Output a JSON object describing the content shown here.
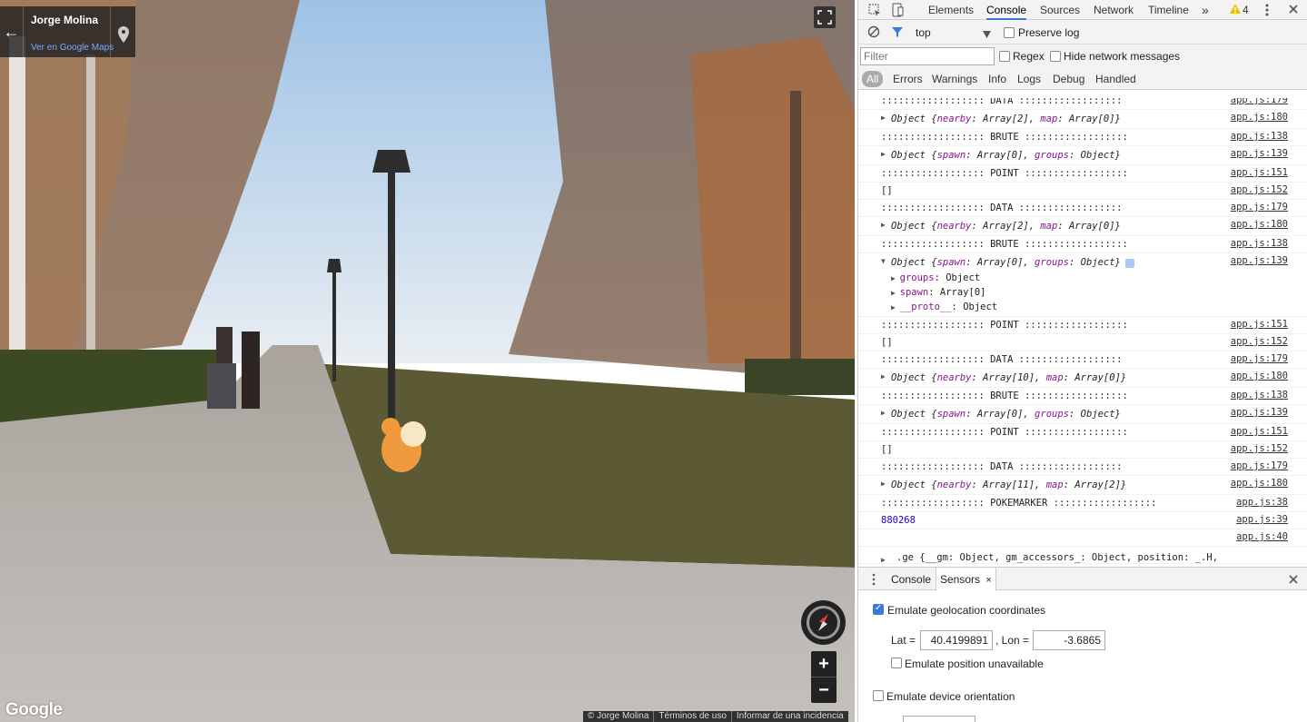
{
  "streetview": {
    "author": "Jorge Molina",
    "maps_link": "Ver en Google Maps",
    "back_glyph": "←",
    "zoom_in": "+",
    "zoom_out": "−",
    "google_logo": "Google",
    "footer": [
      "© Jorge Molina",
      "Términos de uso",
      "Informar de una incidencia"
    ]
  },
  "devtools": {
    "tabs": [
      "Elements",
      "Console",
      "Sources",
      "Network",
      "Timeline"
    ],
    "active_tab": "Console",
    "more_glyph": "»",
    "warning_count": "4",
    "context": "top",
    "preserve_log": "Preserve log",
    "filter_placeholder": "Filter",
    "regex": "Regex",
    "hide_network": "Hide network messages",
    "levels": [
      "All",
      "Errors",
      "Warnings",
      "Info",
      "Logs",
      "Debug",
      "Handled"
    ],
    "console_rows": [
      {
        "type": "text",
        "text": ":::::::::::::::::: DATA ::::::::::::::::::",
        "src": "app.js:179"
      },
      {
        "type": "obj",
        "parts": [
          "Object {",
          "nearby",
          ": Array[2], ",
          "map",
          ": Array[0]}"
        ],
        "src": "app.js:180"
      },
      {
        "type": "text",
        "text": ":::::::::::::::::: BRUTE ::::::::::::::::::",
        "src": "app.js:138"
      },
      {
        "type": "obj",
        "parts": [
          "Object {",
          "spawn",
          ": Array[0], ",
          "groups",
          ": Object}"
        ],
        "src": "app.js:139"
      },
      {
        "type": "text",
        "text": ":::::::::::::::::: POINT ::::::::::::::::::",
        "src": "app.js:151"
      },
      {
        "type": "text",
        "text": "[]",
        "src": "app.js:152"
      },
      {
        "type": "text",
        "text": ":::::::::::::::::: DATA ::::::::::::::::::",
        "src": "app.js:179"
      },
      {
        "type": "obj",
        "parts": [
          "Object {",
          "nearby",
          ": Array[2], ",
          "map",
          ": Array[0]}"
        ],
        "src": "app.js:180"
      },
      {
        "type": "text",
        "text": ":::::::::::::::::: BRUTE ::::::::::::::::::",
        "src": "app.js:138"
      },
      {
        "type": "expanded",
        "parts": [
          "Object {",
          "spawn",
          ": Array[0], ",
          "groups",
          ": Object}"
        ],
        "children": [
          [
            "groups",
            ": Object"
          ],
          [
            "spawn",
            ": Array[0]"
          ],
          [
            "__proto__",
            ": Object"
          ]
        ],
        "src": "app.js:139"
      },
      {
        "type": "text",
        "text": ":::::::::::::::::: POINT ::::::::::::::::::",
        "src": "app.js:151"
      },
      {
        "type": "text",
        "text": "[]",
        "src": "app.js:152"
      },
      {
        "type": "text",
        "text": ":::::::::::::::::: DATA ::::::::::::::::::",
        "src": "app.js:179"
      },
      {
        "type": "obj",
        "parts": [
          "Object {",
          "nearby",
          ": Array[10], ",
          "map",
          ": Array[0]}"
        ],
        "src": "app.js:180"
      },
      {
        "type": "text",
        "text": ":::::::::::::::::: BRUTE ::::::::::::::::::",
        "src": "app.js:138"
      },
      {
        "type": "obj",
        "parts": [
          "Object {",
          "spawn",
          ": Array[0], ",
          "groups",
          ": Object}"
        ],
        "src": "app.js:139"
      },
      {
        "type": "text",
        "text": ":::::::::::::::::: POINT ::::::::::::::::::",
        "src": "app.js:151"
      },
      {
        "type": "text",
        "text": "[]",
        "src": "app.js:152"
      },
      {
        "type": "text",
        "text": ":::::::::::::::::: DATA ::::::::::::::::::",
        "src": "app.js:179"
      },
      {
        "type": "obj",
        "parts": [
          "Object {",
          "nearby",
          ": Array[11], ",
          "map",
          ": Array[2]}"
        ],
        "src": "app.js:180"
      },
      {
        "type": "text",
        "text": ":::::::::::::::::: POKEMARKER ::::::::::::::::::",
        "src": "app.js:38"
      },
      {
        "type": "num",
        "text": "880268",
        "src": "app.js:39"
      },
      {
        "type": "text",
        "text": "",
        "src": "app.js:40"
      },
      {
        "type": "ge",
        "text": ".ge {__gm: Object, gm_accessors_: Object, position: _.H,",
        "src": ""
      }
    ],
    "drawer_tabs": [
      "Console",
      "Sensors"
    ],
    "active_drawer_tab": "Sensors",
    "sensors": {
      "emulate_geolocation": "Emulate geolocation coordinates",
      "emulate_geolocation_checked": true,
      "lat_label": "Lat =",
      "lat_value": "40.4199891",
      "lon_label": ", Lon =",
      "lon_value": "-3.6865",
      "position_unavailable": "Emulate position unavailable",
      "device_orientation": "Emulate device orientation"
    }
  }
}
